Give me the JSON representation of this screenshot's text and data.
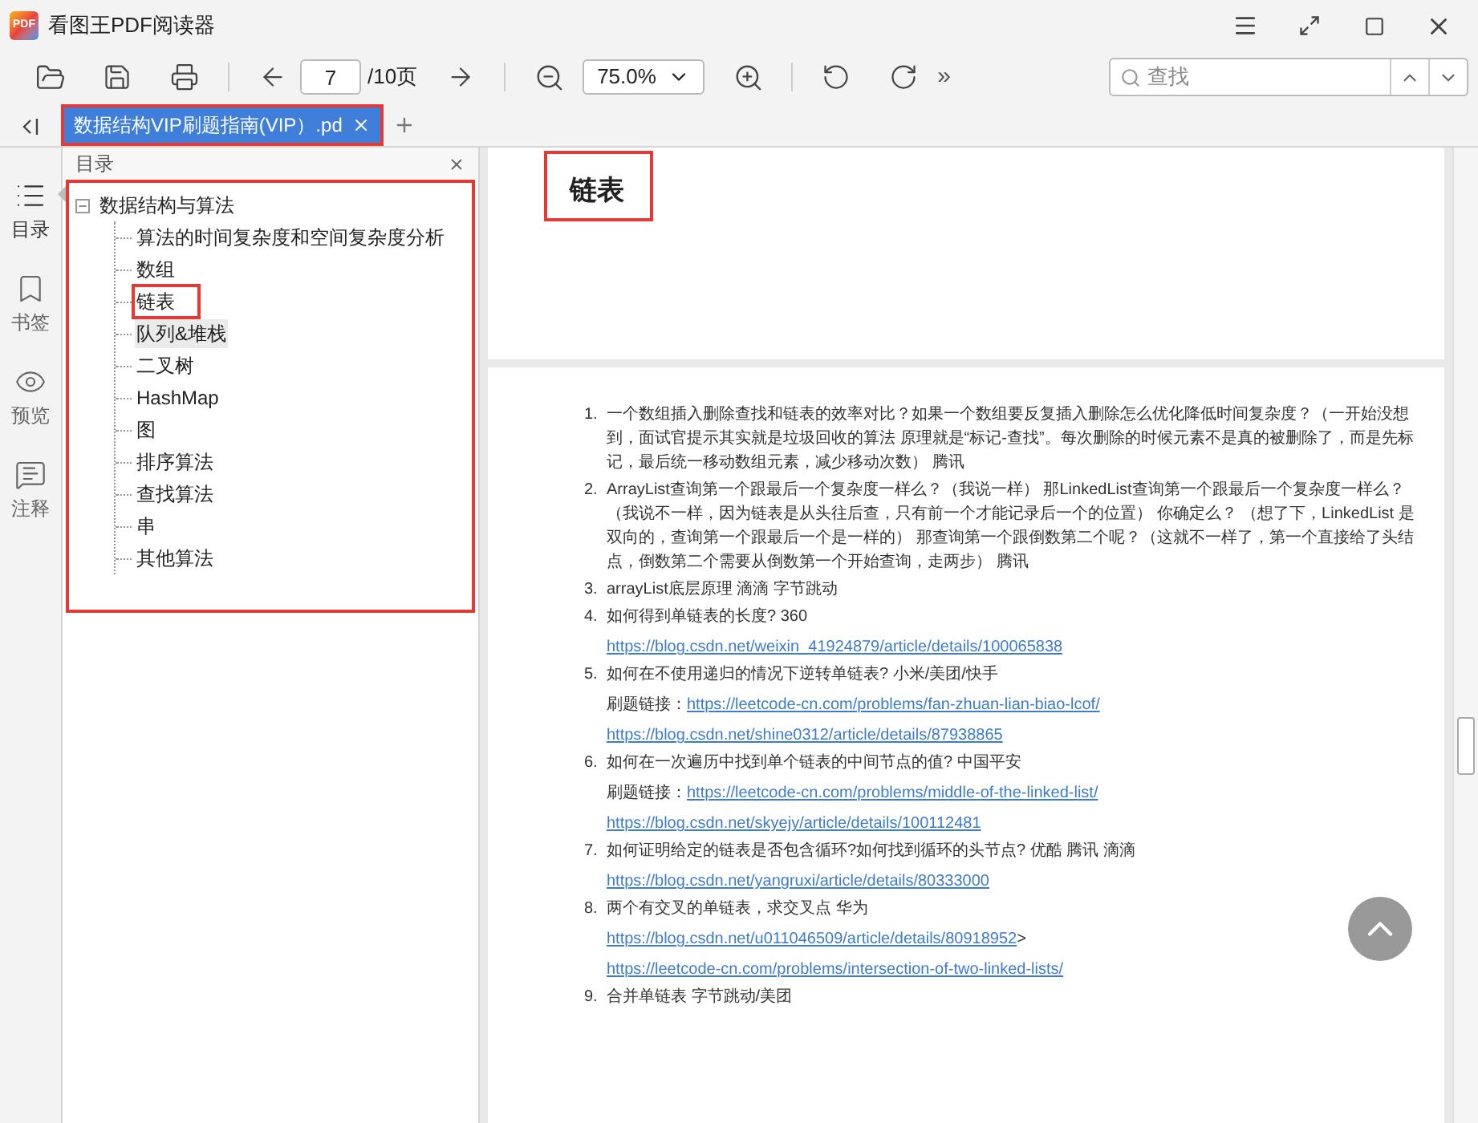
{
  "app": {
    "logo": "PDF",
    "title": "看图王PDF阅读器"
  },
  "toolbar": {
    "page": "7",
    "page_total": "/10页",
    "zoom": "75.0%",
    "more": "»",
    "search_placeholder": "查找"
  },
  "tabs": [
    {
      "label": "数据结构VIP刷题指南(VIP）.pd",
      "selected": true,
      "highlighted": true
    }
  ],
  "sidebar": [
    {
      "kind": "toc",
      "label": "目录",
      "selected": true
    },
    {
      "kind": "bookmark",
      "label": "书签",
      "selected": false
    },
    {
      "kind": "preview",
      "label": "预览",
      "selected": false
    },
    {
      "kind": "notes",
      "label": "注释",
      "selected": false
    }
  ],
  "toc": {
    "title": "目录",
    "highlighted": true,
    "root": {
      "label": "数据结构与算法",
      "expanded": true,
      "children": [
        {
          "label": "算法的时间复杂度和空间复杂度分析",
          "selected": false,
          "highlighted": false
        },
        {
          "label": "数组",
          "selected": false,
          "highlighted": false
        },
        {
          "label": "链表",
          "selected": false,
          "highlighted": true
        },
        {
          "label": "队列&堆栈",
          "selected": true,
          "highlighted": false
        },
        {
          "label": "二叉树",
          "selected": false,
          "highlighted": false
        },
        {
          "label": "HashMap",
          "selected": false,
          "highlighted": false
        },
        {
          "label": "图",
          "selected": false,
          "highlighted": false
        },
        {
          "label": "排序算法",
          "selected": false,
          "highlighted": false
        },
        {
          "label": "查找算法",
          "selected": false,
          "highlighted": false
        },
        {
          "label": "串",
          "selected": false,
          "highlighted": false
        },
        {
          "label": "其他算法",
          "selected": false,
          "highlighted": false
        }
      ]
    }
  },
  "page_heading": {
    "text": "链表",
    "highlighted": true
  },
  "questions": [
    {
      "number": "1.",
      "text": "一个数组插入删除查找和链表的效率对比？如果一个数组要反复插入删除怎么优化降低时间复杂度？（一开始没想到，面试官提示其实就是垃圾回收的算法 原理就是“标记-查找”。每次删除的时候元素不是真的被删除了，而是先标记，最后统一移动数组元素，减少移动次数） 腾讯"
    },
    {
      "number": "2.",
      "text": "ArrayList查询第一个跟最后一个复杂度一样么？（我说一样） 那LinkedList查询第一个跟最后一个复杂度一样么？（我说不一样，因为链表是从头往后查，只有前一个才能记录后一个的位置） 你确定么？ （想了下，LinkedList 是双向的，查询第一个跟最后一个是一样的） 那查询第一个跟倒数第二个呢？（这就不一样了，第一个直接给了头结点，倒数第二个需要从倒数第一个开始查询，走两步） 腾讯"
    },
    {
      "number": "3.",
      "text": "arrayList底层原理 滴滴 字节跳动"
    },
    {
      "number": "4.",
      "text": "如何得到单链表的长度? 360",
      "links": [
        {
          "url": "https://blog.csdn.net/weixin_41924879/article/details/100065838"
        }
      ]
    },
    {
      "number": "5.",
      "text": "如何在不使用递归的情况下逆转单链表? 小米/美团/快手",
      "links": [
        {
          "prefix": "刷题链接：",
          "url": "https://leetcode-cn.com/problems/fan-zhuan-lian-biao-lcof/"
        },
        {
          "url": "https://blog.csdn.net/shine0312/article/details/87938865"
        }
      ]
    },
    {
      "number": "6.",
      "text": "如何在一次遍历中找到单个链表的中间节点的值? 中国平安",
      "links": [
        {
          "prefix": "刷题链接：",
          "url": "https://leetcode-cn.com/problems/middle-of-the-linked-list/"
        },
        {
          "url": "https://blog.csdn.net/skyejy/article/details/100112481"
        }
      ]
    },
    {
      "number": "7.",
      "text": "如何证明给定的链表是否包含循环?如何找到循环的头节点? 优酷 腾讯 滴滴",
      "links": [
        {
          "url": "https://blog.csdn.net/yangruxi/article/details/80333000"
        }
      ]
    },
    {
      "number": "8.",
      "text": "两个有交叉的单链表，求交叉点 华为",
      "links": [
        {
          "url": "https://blog.csdn.net/u011046509/article/details/80918952",
          "suffix": ">"
        },
        {
          "url": "https://leetcode-cn.com/problems/intersection-of-two-linked-lists/"
        }
      ]
    },
    {
      "number": "9.",
      "text": "合并单链表 字节跳动/美团"
    }
  ]
}
